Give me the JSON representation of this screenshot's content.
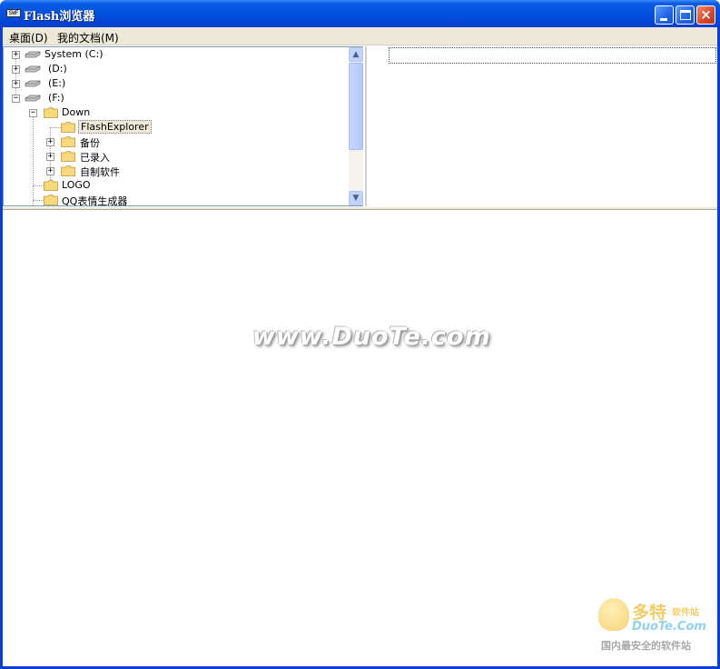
{
  "window": {
    "title": "Flash浏览器",
    "icon_text": "SWF"
  },
  "title_buttons": {
    "minimize": "minimize",
    "maximize": "maximize",
    "close": "×"
  },
  "menu": {
    "items": [
      {
        "label": "桌面(D)"
      },
      {
        "label": "我的文档(M)"
      }
    ]
  },
  "tree": {
    "items": [
      {
        "label": "System (C:)",
        "expander": "+",
        "icon": "drive-icon"
      },
      {
        "label": "(D:)",
        "expander": "+",
        "icon": "drive-icon"
      },
      {
        "label": "(E:)",
        "expander": "+",
        "icon": "drive-icon"
      },
      {
        "label": "(F:)",
        "expander": "−",
        "icon": "drive-icon"
      },
      {
        "label": "Down",
        "expander": "−",
        "icon": "folder-icon"
      },
      {
        "label": "FlashExplorer",
        "expander": "",
        "icon": "folder-icon",
        "selected": true
      },
      {
        "label": "备份",
        "expander": "+",
        "icon": "folder-icon"
      },
      {
        "label": "已录入",
        "expander": "+",
        "icon": "folder-icon"
      },
      {
        "label": "自制软件",
        "expander": "+",
        "icon": "folder-icon"
      },
      {
        "label": "LOGO",
        "expander": "",
        "icon": "folder-icon"
      },
      {
        "label": "QQ表情生成器",
        "expander": "",
        "icon": "folder-icon"
      }
    ],
    "scroll_up": "▲",
    "scroll_down": "▼"
  },
  "watermark": {
    "text": "www.DuoTe.com"
  },
  "logo": {
    "cn": "多特",
    "cn_sub": "软件站",
    "en": "DuoTe.Com",
    "slogan": "国内最安全的软件站"
  },
  "colors": {
    "titlebar": "#0450df",
    "menubar": "#ece9d8",
    "selection": "#ece9d8",
    "folder": "#f7d87a"
  }
}
